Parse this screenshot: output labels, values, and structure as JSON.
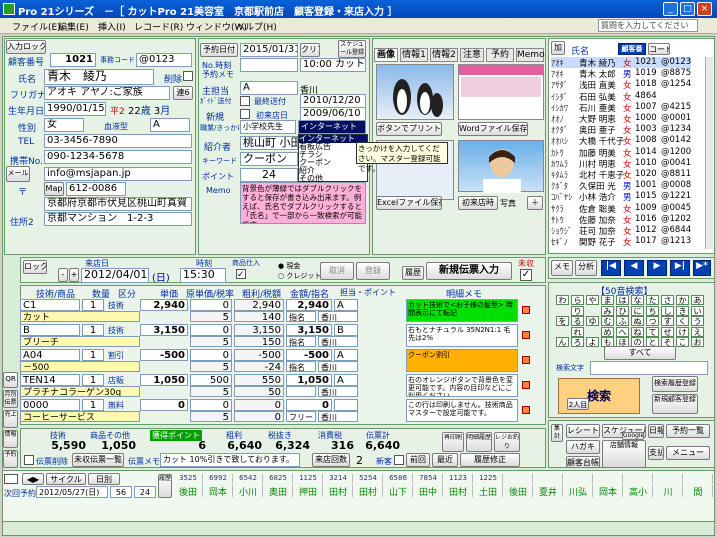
{
  "window": {
    "title": "Pro 21シリーズ　－［ カットPro 21美容室　京都駅前店　顧客登録・来店入力 ］"
  },
  "menu": {
    "items": [
      "ファイル(E)",
      "編集(E)",
      "挿入(I)",
      "レコード(R)",
      "ウィンドウ(W)",
      "ヘルプ(H)"
    ],
    "help_placeholder": "質問を入力してください"
  },
  "customer": {
    "input_lock": "入力ロック",
    "id_label": "顧客番号",
    "id": "1021",
    "reg_label": "事務コード",
    "reg_code": "@0123",
    "name_label": "氏名",
    "name": "青木　綾乃",
    "delete_label": "削除",
    "kana_label": "フリガナ",
    "kana": "アオキ アヤノ:ご家族",
    "family_btn": "連6",
    "birth_label": "生年月日",
    "birth": "1990/01/15",
    "era": "平2",
    "age": "22",
    "age_unit": "歳",
    "month": "3",
    "month_unit": "月",
    "gender_label": "性別",
    "gender": "女",
    "blood_label": "血液型",
    "blood": "A",
    "tel_label": "TEL",
    "tel": "03-3456-7890",
    "mobile_label": "携帯No.",
    "mobile": "090-1234-5678",
    "mail_label": "メール",
    "mail": "info@msjapan.jp",
    "zip_label": "〒",
    "map_btn": "Map",
    "zip": "612-0086",
    "addr_label": "住所1",
    "addr1": "京都府京都市伏見区桃山町真賀",
    "addr2_label": "住所2",
    "addr2": "京都マンション　1-2-3"
  },
  "visit_info": {
    "reserve_btn": "予約日付",
    "date": "2015/01/31",
    "clip_btn": "クリア",
    "schedule_btn": "スケジュール登録",
    "time_label": "No.時刻",
    "time": "10:00",
    "menu_label": "予約メモ",
    "menu": "カット",
    "staff_label": "主担当",
    "staff": "A",
    "staff_name": "香川",
    "first_visit_label": "ｶﾞｲﾄﾞ送付",
    "first_visit": "最終送付",
    "first_date": "2010/12/20",
    "new_label": "新規",
    "new_date_label": "初来店日",
    "new_date": "2009/06/10",
    "job_label": "職業/きっかけ",
    "job": "小学校先生",
    "trigger": "インターネット",
    "intro_label": "紹介者",
    "intro": "桃山町 小田",
    "keyword_label": "キーワード",
    "keyword": "クーポン",
    "count_label": "ポイント",
    "count": "24",
    "memo_label": "Memo",
    "memo": "背景色が薄緑ではダブルクリックをすると保存が書き込み出来ます。例えば、氏名でダブルクリックすると「氏名」で一部から一致検索が可能です"
  },
  "trigger_dropdown": {
    "items": [
      "インターネット",
      "看板広告",
      "チラシ",
      "クーポン",
      "紹介",
      "その他"
    ],
    "tooltip": "きっかけを入力してください。マスター登録可能です。"
  },
  "image_tabs": [
    "画像",
    "情報1",
    "情報2",
    "注意",
    "予約",
    "Memo"
  ],
  "image_buttons": {
    "print": "ボタンでプリント",
    "word": "Wordファイル保存",
    "excel": "Excelファイル保存",
    "first": "初来店時",
    "photo": "写真"
  },
  "customer_list": {
    "header_name": "氏名",
    "header_code": "顧客番号",
    "header_code2": "コード",
    "rows": [
      {
        "kana": "ｱｵｷ",
        "name": "青木 綾乃",
        "g": "女",
        "id": "1021",
        "code": "@0123"
      },
      {
        "kana": "ｱｵｷ",
        "name": "青木 太郎",
        "g": "男",
        "id": "1019",
        "code": "@8875"
      },
      {
        "kana": "ｱｻﾀﾞ",
        "name": "浅田 直美",
        "g": "女",
        "id": "1018",
        "code": "@1254"
      },
      {
        "kana": "ｲｼﾀﾞ",
        "name": "石田 弘美",
        "g": "女",
        "id": "4864",
        "code": ""
      },
      {
        "kana": "ｲｼｶﾜ",
        "name": "石川 亜美",
        "g": "女",
        "id": "1007",
        "code": "@4215"
      },
      {
        "kana": "ｵｵﾉ",
        "name": "大野 明恵",
        "g": "女",
        "id": "1000",
        "code": "@0001"
      },
      {
        "kana": "ｵｸﾀﾞ",
        "name": "奥田 亜子",
        "g": "女",
        "id": "1003",
        "code": "@1234"
      },
      {
        "kana": "ｵｵﾊｼ",
        "name": "大橋 千代子",
        "g": "女",
        "id": "1008",
        "code": "@0142"
      },
      {
        "kana": "ｶﾄｳ",
        "name": "加藤 明美",
        "g": "女",
        "id": "1014",
        "code": "@1200"
      },
      {
        "kana": "ｶﾜﾑﾗ",
        "name": "川村 明恵",
        "g": "女",
        "id": "1010",
        "code": "@0041"
      },
      {
        "kana": "ｷﾀﾑﾗ",
        "name": "北村 千恵子",
        "g": "女",
        "id": "1020",
        "code": "@8811"
      },
      {
        "kana": "ｸﾎﾞﾀ",
        "name": "久保田 光",
        "g": "男",
        "id": "1001",
        "code": "@0008"
      },
      {
        "kana": "ｺﾊﾞﾔｼ",
        "name": "小林 浩介",
        "g": "男",
        "id": "1015",
        "code": "@1221"
      },
      {
        "kana": "ｻｸﾗ",
        "name": "佐倉 聡美",
        "g": "女",
        "id": "1009",
        "code": "@0045"
      },
      {
        "kana": "ｻﾄｳ",
        "name": "佐藤 加奈",
        "g": "女",
        "id": "1016",
        "code": "@1202"
      },
      {
        "kana": "ｼｮｳｼﾞ",
        "name": "荘司 加奈",
        "g": "女",
        "id": "1012",
        "code": "@6844"
      },
      {
        "kana": "ｾｷﾞﾉ",
        "name": "関野 花子",
        "g": "女",
        "id": "1017",
        "code": "@1213"
      }
    ]
  },
  "visit": {
    "lock": "ロック",
    "date_label": "来店日",
    "date": "2012/04/01",
    "weekday": "(日)",
    "time_label": "時刻",
    "time": "15:30",
    "prod_label": "商品仕入",
    "cash": "現金",
    "credit": "クレジット",
    "cancel": "取消",
    "register": "登録",
    "history": "履歴",
    "new_slip": "新規伝票入力",
    "uncomp": "未収"
  },
  "slip": {
    "headers": [
      "技術/商品",
      "数量",
      "区分",
      "単価",
      "原単価/税率",
      "粗利/税額",
      "金額/指名",
      "担当・ポイント",
      "明細メモ"
    ],
    "rows": [
      {
        "code": "C1",
        "qty": "1",
        "type": "技術",
        "price": "2,940",
        "cost": "0",
        "profit": "2,940",
        "amount": "2,940",
        "staff": "A",
        "name": "カット",
        "tax": "5",
        "taxamt": "140",
        "shimei": "指名",
        "staff2": "香川",
        "pt": "",
        "memo": "カット技術で<お子様の髪型> 時間表示にて転記",
        "memocolor": "green"
      },
      {
        "code": "B",
        "qty": "1",
        "type": "技術",
        "price": "3,150",
        "cost": "0",
        "profit": "3,150",
        "amount": "3,150",
        "staff": "B",
        "name": "ブリーチ",
        "tax": "5",
        "taxamt": "150",
        "shimei": "指名",
        "staff2": "香川",
        "pt": "",
        "memo": "右もとナチュラル 35N2N1:1 毛先は2%",
        "memocolor": "white"
      },
      {
        "code": "A04",
        "qty": "1",
        "type": "割引",
        "price": "-500",
        "cost": "0",
        "profit": "-500",
        "amount": "-500",
        "staff": "A",
        "name": "－500",
        "tax": "5",
        "taxamt": "-24",
        "shimei": "指名",
        "staff2": "香川",
        "pt": "",
        "memo": "クーポン割引",
        "memocolor": "orange"
      },
      {
        "code": "TEN14",
        "qty": "1",
        "type": "店販",
        "price": "1,050",
        "cost": "500",
        "profit": "550",
        "amount": "1,050",
        "staff": "A",
        "name": "プラチナコラーゲン30g",
        "tax": "5",
        "taxamt": "50",
        "shimei": "",
        "staff2": "香川",
        "pt": "",
        "memo": "右のオレンジボタンで背景色を変更可能です。内容の目印などにご利用ください。",
        "memocolor": "white"
      },
      {
        "code": "0000",
        "qty": "1",
        "type": "無料",
        "price": "0",
        "cost": "0",
        "profit": "0",
        "amount": "0",
        "staff": "",
        "name": "コーヒーサービス",
        "tax": "5",
        "taxamt": "0",
        "shimei": "フリー",
        "staff2": "香川",
        "pt": "",
        "memo": "この行は印刷しません。技術商品マスターで設定可能です。",
        "memocolor": "white"
      }
    ]
  },
  "totals": {
    "tech_label": "技術",
    "goods_label": "商品その他",
    "point_label": "獲得ポイント",
    "profit_label": "粗利",
    "tax_label": "税抜き",
    "consume_label": "消費税",
    "total_label": "伝票計",
    "tech": "5,590",
    "goods": "1,050",
    "point": "6",
    "profit": "6,640",
    "taxex": "6,324",
    "consume": "316",
    "total": "6,640",
    "slip_delete": "伝票削除",
    "unfinished": "未収伝票一覧",
    "memo_label": "伝票メモ",
    "memo": "カット 10%引きで致しております。",
    "slip_count_label": "来店回数",
    "slip_count": "2",
    "new_label": "新客",
    "prev": "前回",
    "latest": "最近",
    "history_fix": "履歴修正"
  },
  "right_panel": {
    "memo": "メモ",
    "analysis": "分析",
    "kana_title": "50音検索",
    "kana": [
      "わ",
      "ら",
      "や",
      "ま",
      "は",
      "な",
      "た",
      "さ",
      "か",
      "あ",
      "",
      "り",
      "",
      "み",
      "ひ",
      "に",
      "ち",
      "し",
      "き",
      "い",
      "を",
      "る",
      "ゆ",
      "む",
      "ふ",
      "ぬ",
      "つ",
      "す",
      "く",
      "う",
      "",
      "れ",
      "",
      "め",
      "へ",
      "ね",
      "て",
      "せ",
      "け",
      "え",
      "ん",
      "ろ",
      "よ",
      "も",
      "ほ",
      "の",
      "と",
      "そ",
      "こ",
      "お"
    ],
    "all": "すべて",
    "search_label": "検索文字",
    "search_btn": "検索",
    "result": "2人目",
    "search_history": "検索履歴登録",
    "new_register": "新規顧客登録",
    "receipt": "レシート",
    "schedule": "スケジュール",
    "hagaki": "ハガキ",
    "ledger": "顧客台帳",
    "google": "Google",
    "notice": "告知",
    "payment": "支払",
    "daily": "日報",
    "reserve_list": "予約一覧",
    "menu_btn": "メニュー",
    "store_info": "店舗情報"
  },
  "left_side": {
    "qr": "QR",
    "pos": "月別伝票",
    "sales": "売上",
    "info": "情報",
    "reserve": "予約"
  },
  "footer": {
    "next_label": "次回予約",
    "next_date": "2012/05/27(日)",
    "weeks": "56",
    "days": "24",
    "cycle": "サイクル",
    "daily_label": "日別",
    "cols": [
      {
        "v": "3525",
        "n": "後田"
      },
      {
        "v": "6992",
        "n": "岡本"
      },
      {
        "v": "6542",
        "n": "小川"
      },
      {
        "v": "6825",
        "n": "奥田"
      },
      {
        "v": "1125",
        "n": "押田"
      },
      {
        "v": "3214",
        "n": "田村"
      },
      {
        "v": "5254",
        "n": "田村"
      },
      {
        "v": "6586",
        "n": "山下"
      },
      {
        "v": "7854",
        "n": "田中"
      },
      {
        "v": "1123",
        "n": "田村"
      },
      {
        "v": "1225",
        "n": "土田"
      },
      {
        "v": "",
        "n": "後田"
      },
      {
        "v": "",
        "n": "夏井"
      },
      {
        "v": "",
        "n": "川弘"
      },
      {
        "v": "",
        "n": "岡本"
      },
      {
        "v": "",
        "n": "高小"
      },
      {
        "v": "",
        "n": "川"
      },
      {
        "v": "",
        "n": "間"
      }
    ]
  }
}
